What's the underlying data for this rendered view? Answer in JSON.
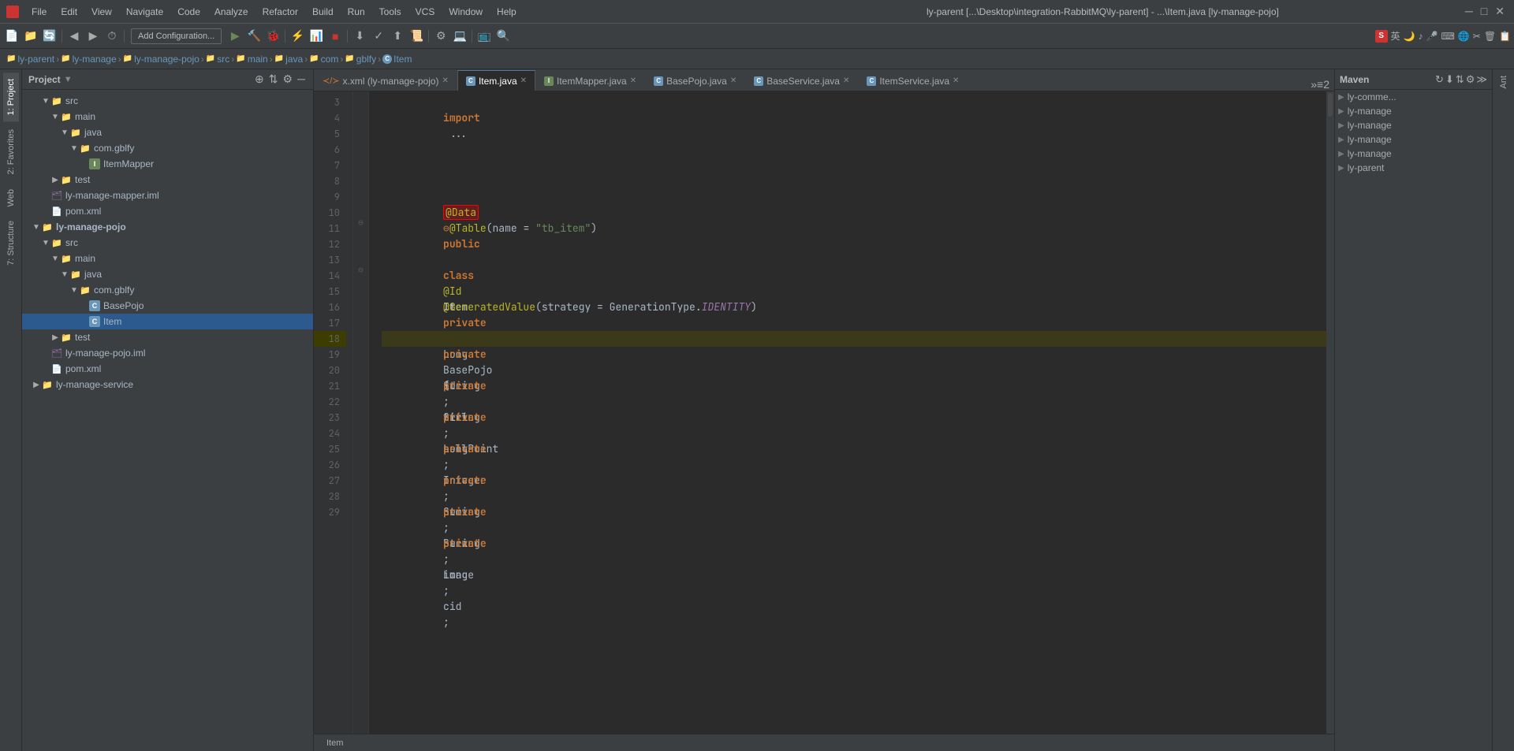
{
  "titlebar": {
    "title": "ly-parent [...\\Desktop\\integration-RabbitMQ\\ly-parent] - ...\\Item.java [ly-manage-pojo]",
    "menus": [
      "File",
      "Edit",
      "View",
      "Navigate",
      "Code",
      "Analyze",
      "Refactor",
      "Build",
      "Run",
      "Tools",
      "VCS",
      "Window",
      "Help"
    ]
  },
  "toolbar": {
    "add_config_label": "Add Configuration...",
    "search_icon": "🔍"
  },
  "breadcrumb": {
    "items": [
      "ly-parent",
      "ly-manage",
      "ly-manage-pojo",
      "src",
      "main",
      "java",
      "com",
      "gblfy",
      "Item"
    ]
  },
  "project_panel": {
    "title": "Project",
    "tree": [
      {
        "id": "src1",
        "label": "src",
        "type": "folder",
        "depth": 1,
        "expanded": true,
        "parent": "ly-manage-mapper"
      },
      {
        "id": "main1",
        "label": "main",
        "type": "folder",
        "depth": 2,
        "expanded": true
      },
      {
        "id": "java1",
        "label": "java",
        "type": "folder",
        "depth": 3,
        "expanded": true
      },
      {
        "id": "com1",
        "label": "com.gblfy",
        "type": "folder",
        "depth": 4,
        "expanded": true
      },
      {
        "id": "itemmapper",
        "label": "ItemMapper",
        "type": "interface",
        "depth": 5
      },
      {
        "id": "test1",
        "label": "test",
        "type": "folder",
        "depth": 2
      },
      {
        "id": "mapper_iml",
        "label": "ly-manage-mapper.iml",
        "type": "iml",
        "depth": 1
      },
      {
        "id": "mapper_pom",
        "label": "pom.xml",
        "type": "xml",
        "depth": 1
      },
      {
        "id": "ly-manage-pojo",
        "label": "ly-manage-pojo",
        "type": "module",
        "depth": 0,
        "expanded": true
      },
      {
        "id": "src2",
        "label": "src",
        "type": "folder",
        "depth": 1,
        "expanded": true
      },
      {
        "id": "main2",
        "label": "main",
        "type": "folder",
        "depth": 2,
        "expanded": true
      },
      {
        "id": "java2",
        "label": "java",
        "type": "folder",
        "depth": 3,
        "expanded": true
      },
      {
        "id": "com2",
        "label": "com.gblfy",
        "type": "folder",
        "depth": 4,
        "expanded": true
      },
      {
        "id": "basepojo",
        "label": "BasePojo",
        "type": "class",
        "depth": 5
      },
      {
        "id": "item",
        "label": "Item",
        "type": "class",
        "depth": 5,
        "selected": true
      },
      {
        "id": "test2",
        "label": "test",
        "type": "folder",
        "depth": 2
      },
      {
        "id": "pojo_iml",
        "label": "ly-manage-pojo.iml",
        "type": "iml",
        "depth": 1
      },
      {
        "id": "pojo_pom",
        "label": "pom.xml",
        "type": "xml",
        "depth": 1
      },
      {
        "id": "ly-manage-service",
        "label": "ly-manage-service",
        "type": "module",
        "depth": 0
      }
    ]
  },
  "editor": {
    "tabs": [
      {
        "label": "x.xml (ly-manage-pojo)",
        "type": "xml",
        "active": false
      },
      {
        "label": "Item.java",
        "type": "class",
        "active": true
      },
      {
        "label": "ItemMapper.java",
        "type": "interface",
        "active": false
      },
      {
        "label": "BasePojo.java",
        "type": "class",
        "active": false
      },
      {
        "label": "BaseService.java",
        "type": "class",
        "active": false
      },
      {
        "label": "ItemService.java",
        "type": "class",
        "active": false
      }
    ],
    "lines": [
      {
        "num": 3,
        "content": "import ...",
        "type": "import"
      },
      {
        "num": 4,
        "content": "",
        "type": "empty"
      },
      {
        "num": 5,
        "content": "",
        "type": "empty"
      },
      {
        "num": 6,
        "content": "",
        "type": "empty"
      },
      {
        "num": 7,
        "content": "",
        "type": "empty"
      },
      {
        "num": 8,
        "content": "",
        "type": "empty"
      },
      {
        "num": 9,
        "content": "@Data",
        "type": "annotation",
        "highlighted": true
      },
      {
        "num": 10,
        "content": "@Table(name = \"tb_item\")",
        "type": "annotation"
      },
      {
        "num": 11,
        "content": "public class Item extends BasePojo{",
        "type": "class_decl"
      },
      {
        "num": 12,
        "content": "",
        "type": "empty"
      },
      {
        "num": 13,
        "content": "    @Id",
        "type": "annotation"
      },
      {
        "num": 14,
        "content": "    @GeneratedValue(strategy = GenerationType.IDENTITY)",
        "type": "annotation"
      },
      {
        "num": 15,
        "content": "    private Long id;",
        "type": "field"
      },
      {
        "num": 16,
        "content": "",
        "type": "empty"
      },
      {
        "num": 17,
        "content": "    private String title;",
        "type": "field"
      },
      {
        "num": 18,
        "content": "",
        "type": "empty",
        "current": true
      },
      {
        "num": 19,
        "content": "    private String sellPoint;",
        "type": "field"
      },
      {
        "num": 20,
        "content": "",
        "type": "empty"
      },
      {
        "num": 21,
        "content": "    private Long price;",
        "type": "field"
      },
      {
        "num": 22,
        "content": "",
        "type": "empty"
      },
      {
        "num": 23,
        "content": "    private Integer num;",
        "type": "field"
      },
      {
        "num": 24,
        "content": "",
        "type": "empty"
      },
      {
        "num": 25,
        "content": "    private String barcode;",
        "type": "field"
      },
      {
        "num": 26,
        "content": "",
        "type": "empty"
      },
      {
        "num": 27,
        "content": "    private String image;",
        "type": "field"
      },
      {
        "num": 28,
        "content": "",
        "type": "empty"
      },
      {
        "num": 29,
        "content": "    private Long cid;",
        "type": "field"
      }
    ]
  },
  "maven_panel": {
    "title": "Maven",
    "items": [
      "ly-comme...",
      "ly-manage",
      "ly-manage",
      "ly-manage",
      "ly-manage",
      "ly-parent"
    ]
  },
  "status_bar": {
    "text": "Item"
  },
  "right_vertical_tabs": [
    "Ant"
  ],
  "left_vertical_tabs": [
    "1: Project",
    "2: Favorites",
    "Web",
    "7: Structure"
  ],
  "sog_toolbar": {
    "items": [
      "S",
      "英",
      "🌙",
      "♪",
      "🎤",
      "⌨",
      "🌐",
      "✂",
      "🗑",
      "📋"
    ]
  }
}
